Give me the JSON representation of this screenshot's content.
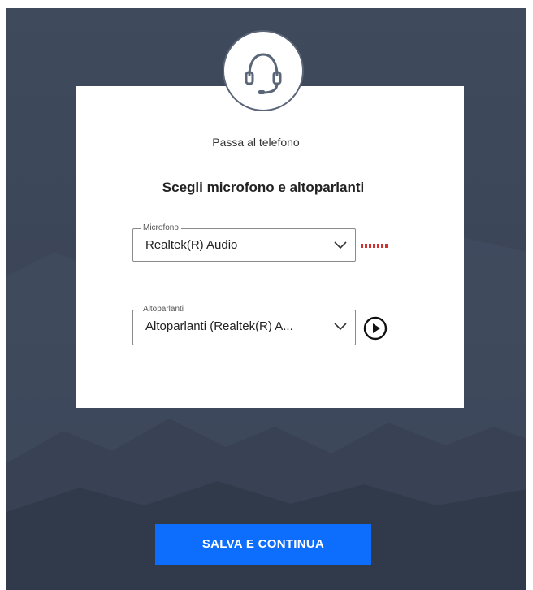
{
  "dialog": {
    "switch_to_phone_link": "Passa al telefono",
    "title": "Scegli microfono e altoparlanti"
  },
  "microphone": {
    "legend": "Microfono",
    "selected": "Realtek(R) Audio",
    "level_meter_color": "#d32f2f",
    "level": 0
  },
  "speakers": {
    "legend": "Altoparlanti",
    "selected": "Altoparlanti (Realtek(R) A..."
  },
  "actions": {
    "save_continue": "SALVA E CONTINUA"
  },
  "icons": {
    "header": "headset-icon",
    "dropdown": "chevron-down-icon",
    "play": "play-circle-icon"
  },
  "colors": {
    "background": "#3d4759",
    "card": "#ffffff",
    "primary_button": "#0d6efd"
  }
}
